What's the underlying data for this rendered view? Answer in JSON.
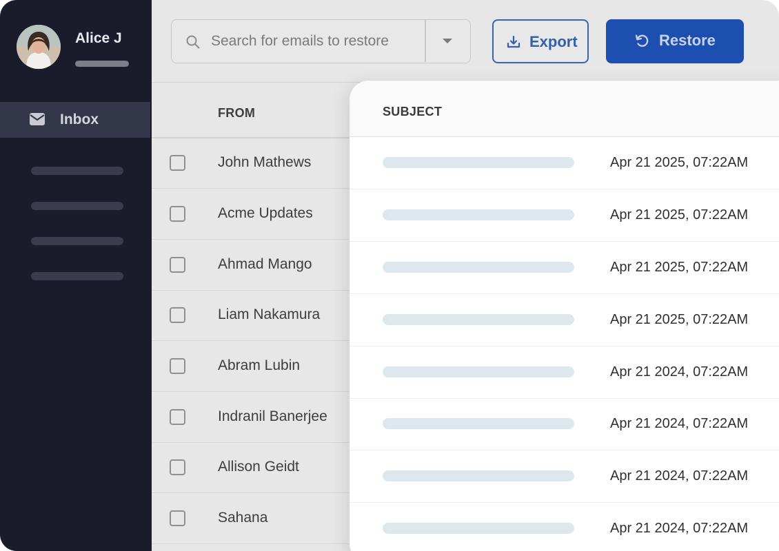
{
  "user": {
    "name": "Alice J"
  },
  "sidebar": {
    "inbox_label": "Inbox"
  },
  "search": {
    "placeholder": "Search for emails to restore"
  },
  "toolbar": {
    "export_label": "Export",
    "restore_label": "Restore"
  },
  "table": {
    "from_header": "FROM",
    "rows": [
      {
        "from": "John Mathews"
      },
      {
        "from": "Acme Updates"
      },
      {
        "from": "Ahmad Mango"
      },
      {
        "from": "Liam Nakamura"
      },
      {
        "from": "Abram Lubin"
      },
      {
        "from": "Indranil Banerjee"
      },
      {
        "from": "Allison Geidt"
      },
      {
        "from": "Sahana"
      }
    ]
  },
  "panel": {
    "subject_header": "SUBJECT",
    "rows": [
      {
        "date": "Apr 21 2025, 07:22AM"
      },
      {
        "date": "Apr 21 2025, 07:22AM"
      },
      {
        "date": "Apr 21 2025, 07:22AM"
      },
      {
        "date": "Apr 21 2025, 07:22AM"
      },
      {
        "date": "Apr 21 2024, 07:22AM"
      },
      {
        "date": "Apr 21 2024, 07:22AM"
      },
      {
        "date": "Apr 21 2024, 07:22AM"
      },
      {
        "date": "Apr 21 2024, 07:22AM"
      }
    ]
  },
  "colors": {
    "sidebar_bg": "#1a1c2c",
    "primary": "#1d4fb0",
    "export_accent": "#3360a8",
    "placeholder_bar": "#dde7ee"
  }
}
